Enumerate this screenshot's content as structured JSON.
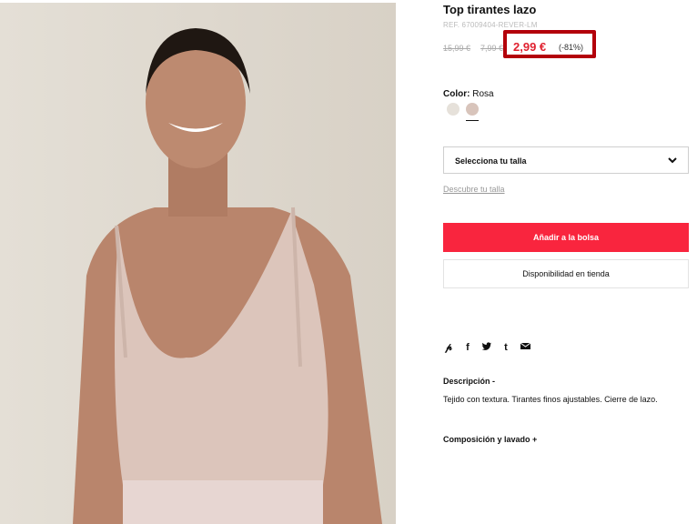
{
  "product": {
    "title": "Top tirantes lazo",
    "ref": "REF. 67009404-REVER-LM",
    "original_price": "15,99 €",
    "previous_price": "7,99 €",
    "current_price": "2,99 €",
    "discount": "(-81%)"
  },
  "color": {
    "label": "Color:",
    "value": "Rosa",
    "swatches": [
      "#e6e1da",
      "#d8c4bb"
    ],
    "selected_index": 1
  },
  "size": {
    "placeholder": "Selecciona tu talla",
    "guide_link": "Descubre tu talla"
  },
  "actions": {
    "add_to_bag": "Añadir a la bolsa",
    "store_availability": "Disponibilidad en tienda"
  },
  "share_icons": [
    "pinterest-icon",
    "facebook-icon",
    "twitter-icon",
    "tumblr-icon",
    "email-icon"
  ],
  "description": {
    "title": "Descripción -",
    "text": "Tejido con textura. Tirantes finos ajustables. Cierre de lazo."
  },
  "composition": {
    "title": "Composición y lavado +"
  },
  "colors": {
    "accent": "#f9253e",
    "price_red": "#e0212f",
    "highlight_box": "#b3000a"
  }
}
